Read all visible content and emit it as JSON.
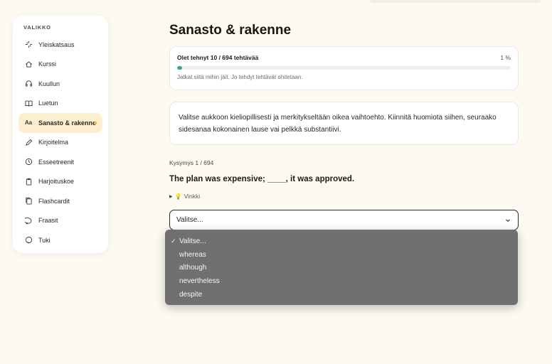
{
  "sidebar": {
    "heading": "VALIKKO",
    "items": [
      {
        "label": "Yleiskatsaus",
        "icon": "sparkles-icon"
      },
      {
        "label": "Kurssi",
        "icon": "home-icon"
      },
      {
        "label": "Kuullun",
        "icon": "headphones-icon"
      },
      {
        "label": "Luetun",
        "icon": "book-icon"
      },
      {
        "label": "Sanasto & rakenne",
        "icon": "text-icon",
        "active": true
      },
      {
        "label": "Kirjoitelma",
        "icon": "pencil-icon"
      },
      {
        "label": "Esseetreenit",
        "icon": "clock-icon"
      },
      {
        "label": "Harjoituskoe",
        "icon": "clipboard-icon"
      },
      {
        "label": "Flashcardit",
        "icon": "cards-icon"
      },
      {
        "label": "Fraasit",
        "icon": "chat-icon"
      },
      {
        "label": "Tuki",
        "icon": "support-icon"
      }
    ],
    "accent_color": "#fbefcf",
    "dot_color": "#e8b93a"
  },
  "main": {
    "title": "Sanasto & rakenne",
    "progress": {
      "label": "Olet tehnyt 10 / 694 tehtävää",
      "percent_label": "1 %",
      "fraction": 0.014,
      "note": "Jatkat siitä mihin jäit. Jo tehdyt tehtävät ohitetaan.",
      "bar_color": "#2fb36c"
    },
    "instruction": "Valitse aukkoon kieliopillisesti ja merkitykseltään oikea vaihtoehto. Kiinnitä huomiota siihen, seuraako sidesanaa kokonainen lause vai pelkkä substantiivi.",
    "question_counter": "Kysymys 1 / 694",
    "question": "The plan was expensive; ____, it was approved.",
    "hint_label": "Vinkki",
    "select": {
      "value": "Valitse...",
      "options": [
        "Valitse...",
        "whereas",
        "although",
        "nevertheless",
        "despite"
      ],
      "selected_index": 0
    }
  }
}
